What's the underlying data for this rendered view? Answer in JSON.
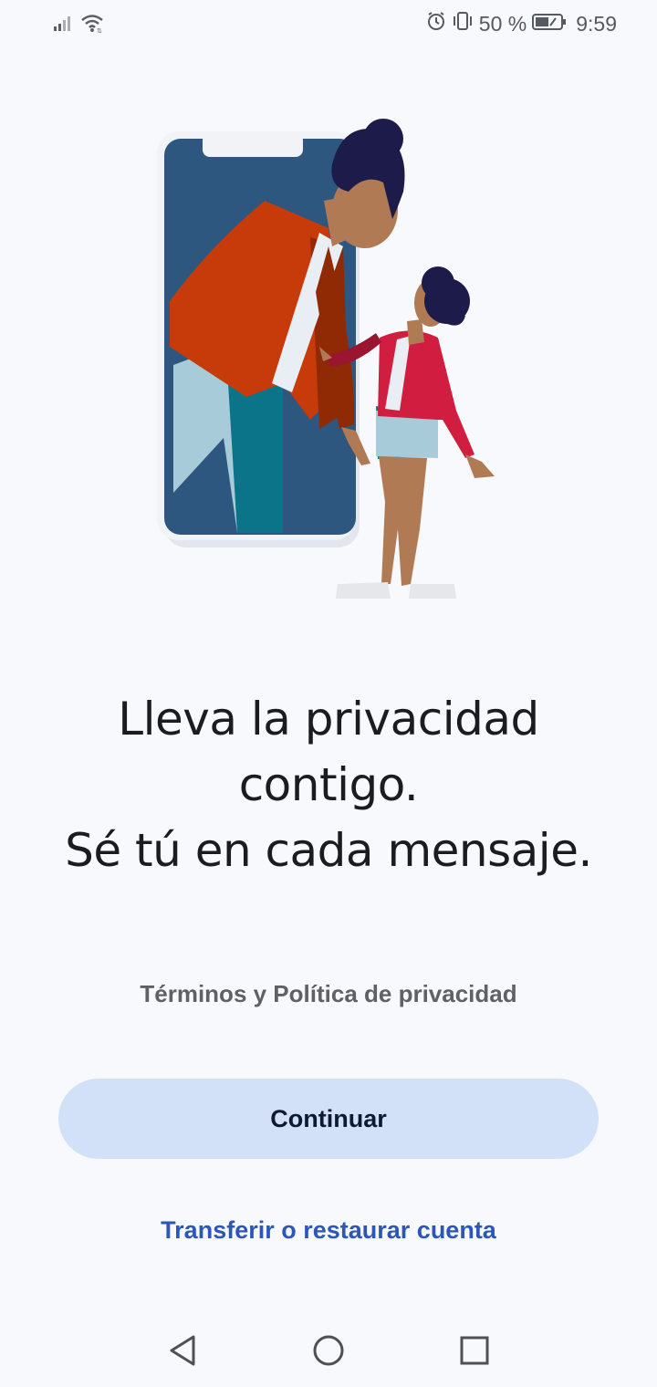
{
  "status_bar": {
    "battery_percent": "50 %",
    "time": "9:59",
    "icons": [
      "signal-icon",
      "wifi-icon",
      "alarm-icon",
      "vibrate-icon",
      "battery-icon"
    ]
  },
  "welcome": {
    "headline_lines": [
      "Lleva la privacidad",
      "contigo.",
      "Sé tú en cada mensaje."
    ],
    "terms_link": "Términos y Política de privacidad",
    "continue_label": "Continuar",
    "transfer_label": "Transferir o restaurar cuenta"
  },
  "nav_bar": {
    "icons": [
      "back-icon",
      "home-icon",
      "recents-icon"
    ]
  },
  "colors": {
    "background": "#f8f9fd",
    "button_bg": "#d2e0f8",
    "link": "#2c56b8",
    "headline": "#1b1c1f"
  }
}
